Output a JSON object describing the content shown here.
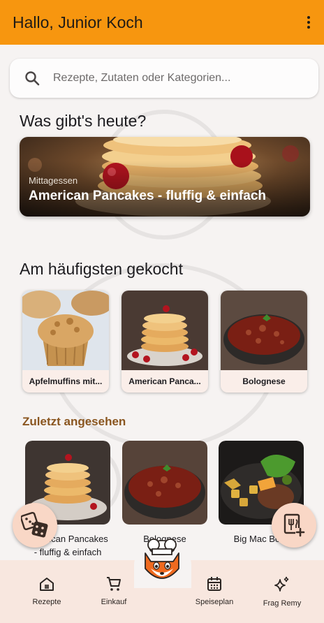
{
  "header": {
    "title": "Hallo, Junior Koch",
    "menu_icon": "more-vert-icon"
  },
  "search": {
    "placeholder": "Rezepte, Zutaten oder Kategorien..."
  },
  "today": {
    "section_title": "Was gibt's heute?",
    "category": "Mittagessen",
    "title": "American Pancakes - fluffig & einfach"
  },
  "favorites": {
    "section_title": "Am häufigsten gekocht",
    "items": [
      {
        "label": "Apfelmuffins mit..."
      },
      {
        "label": "American Panca..."
      },
      {
        "label": "Bolognese"
      }
    ]
  },
  "recent": {
    "section_title": "Zuletzt angesehen",
    "items": [
      {
        "line1": "American Pancakes",
        "line2": "- fluffig & einfach"
      },
      {
        "line1": "Bolognese",
        "line2": ""
      },
      {
        "line1": "Big Mac Bowl",
        "line2": ""
      }
    ]
  },
  "fabs": {
    "left_icon": "dice-icon",
    "right_icon": "add-recipe-icon"
  },
  "nav": {
    "items": [
      {
        "label": "Rezepte",
        "icon": "home-icon"
      },
      {
        "label": "Einkauf",
        "icon": "cart-icon"
      },
      {
        "label": "Speiseplan",
        "icon": "calendar-icon"
      },
      {
        "label": "Frag Remy",
        "icon": "sparkle-icon"
      }
    ],
    "center_icon": "chef-fox-icon"
  },
  "colors": {
    "app_bar": "#f7960f",
    "accent_text": "#8a5620",
    "nav_bg": "#f8e7df",
    "card_bg": "#faeee9"
  }
}
